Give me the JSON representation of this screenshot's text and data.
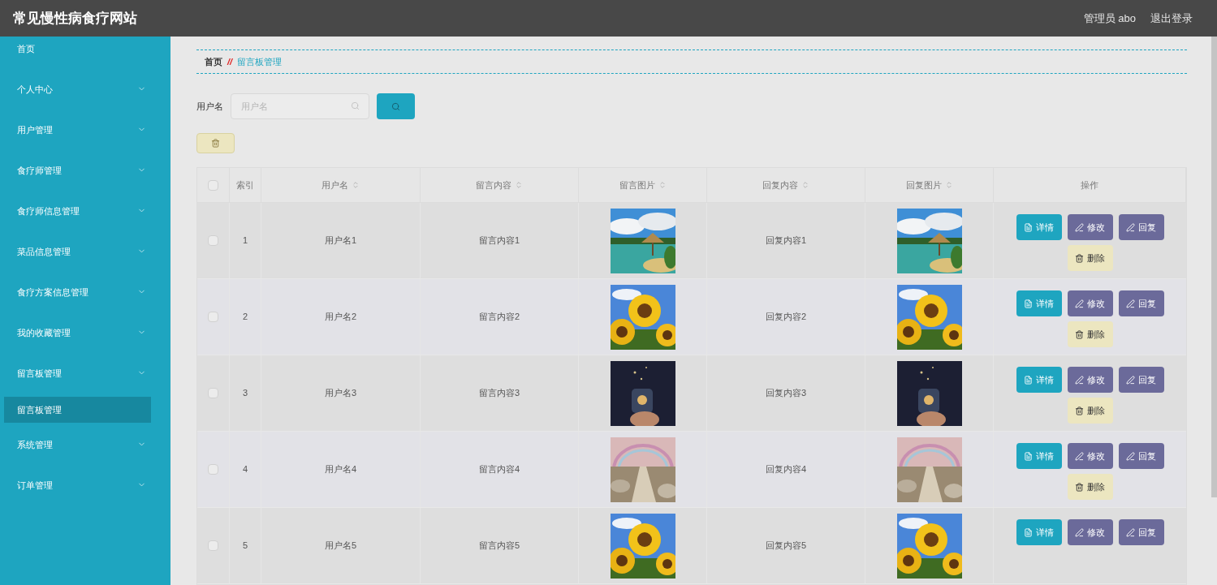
{
  "header": {
    "title": "常见慢性病食疗网站",
    "user": "管理员 abo",
    "logout": "退出登录"
  },
  "sidebar": {
    "items": [
      {
        "label": "首页",
        "kind": "link"
      },
      {
        "label": "个人中心",
        "kind": "group"
      },
      {
        "label": "用户管理",
        "kind": "group"
      },
      {
        "label": "食疗师管理",
        "kind": "group"
      },
      {
        "label": "食疗师信息管理",
        "kind": "group"
      },
      {
        "label": "菜品信息管理",
        "kind": "group"
      },
      {
        "label": "食疗方案信息管理",
        "kind": "group"
      },
      {
        "label": "我的收藏管理",
        "kind": "group"
      },
      {
        "label": "留言板管理",
        "kind": "group",
        "children": [
          {
            "label": "留言板管理",
            "selected": true
          }
        ]
      },
      {
        "label": "系统管理",
        "kind": "group"
      },
      {
        "label": "订单管理",
        "kind": "group"
      }
    ]
  },
  "breadcrumb": {
    "home": "首页",
    "separator": "//",
    "current": "留言板管理"
  },
  "search": {
    "label": "用户名",
    "placeholder": "用户名"
  },
  "table": {
    "all_checked": false,
    "columns": [
      {
        "label": "索引",
        "sortable": false
      },
      {
        "label": "用户名",
        "sortable": true
      },
      {
        "label": "留言内容",
        "sortable": true
      },
      {
        "label": "留言图片",
        "sortable": true
      },
      {
        "label": "回复内容",
        "sortable": true
      },
      {
        "label": "回复图片",
        "sortable": true
      },
      {
        "label": "操作",
        "sortable": false
      }
    ],
    "rows": [
      {
        "checked": false,
        "index": "1",
        "username": "用户名1",
        "message": "留言内容1",
        "message_image": {
          "kind": "picture"
        },
        "reply": "回复内容1",
        "reply_image": {
          "kind": "picture"
        },
        "actions": [
          {
            "label": "详情",
            "kind": "detail"
          },
          {
            "label": "修改",
            "kind": "edit"
          },
          {
            "label": "回复",
            "kind": "reply"
          },
          {
            "label": "删除",
            "kind": "delete"
          }
        ]
      },
      {
        "checked": false,
        "index": "2",
        "username": "用户名2",
        "message": "留言内容2",
        "message_image": {
          "kind": "picture"
        },
        "reply": "回复内容2",
        "reply_image": {
          "kind": "picture"
        },
        "actions": [
          {
            "label": "详情",
            "kind": "detail"
          },
          {
            "label": "修改",
            "kind": "edit"
          },
          {
            "label": "回复",
            "kind": "reply"
          },
          {
            "label": "删除",
            "kind": "delete"
          }
        ]
      },
      {
        "checked": false,
        "index": "3",
        "username": "用户名3",
        "message": "留言内容3",
        "message_image": {
          "kind": "picture"
        },
        "reply": "回复内容3",
        "reply_image": {
          "kind": "picture"
        },
        "actions": [
          {
            "label": "详情",
            "kind": "detail"
          },
          {
            "label": "修改",
            "kind": "edit"
          },
          {
            "label": "回复",
            "kind": "reply"
          },
          {
            "label": "删除",
            "kind": "delete"
          }
        ]
      },
      {
        "checked": false,
        "index": "4",
        "username": "用户名4",
        "message": "留言内容4",
        "message_image": {
          "kind": "picture"
        },
        "reply": "回复内容4",
        "reply_image": {
          "kind": "picture"
        },
        "actions": [
          {
            "label": "详情",
            "kind": "detail"
          },
          {
            "label": "修改",
            "kind": "edit"
          },
          {
            "label": "回复",
            "kind": "reply"
          },
          {
            "label": "删除",
            "kind": "delete"
          }
        ]
      },
      {
        "checked": false,
        "index": "5",
        "username": "用户名5",
        "message": "留言内容5",
        "message_image": {
          "kind": "picture"
        },
        "reply": "回复内容5",
        "reply_image": {
          "kind": "picture"
        },
        "actions": [
          {
            "label": "详情",
            "kind": "detail"
          },
          {
            "label": "修改",
            "kind": "edit"
          },
          {
            "label": "回复",
            "kind": "reply"
          }
        ]
      }
    ]
  }
}
